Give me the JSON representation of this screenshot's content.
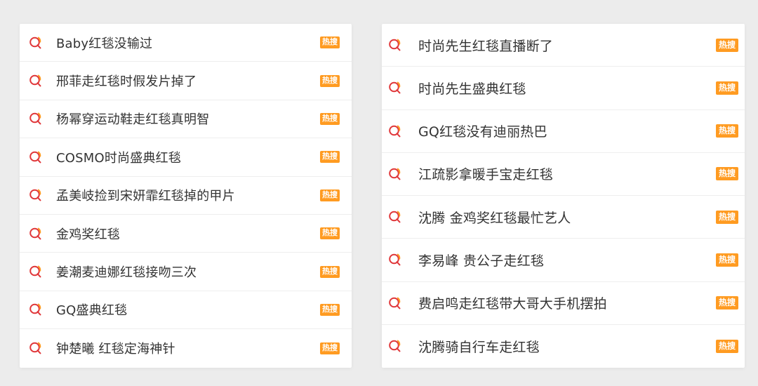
{
  "colors": {
    "badge": "#ff9b21",
    "icon_red": "#e0373a",
    "icon_orange": "#ff9b21"
  },
  "left_list": [
    {
      "label": "Baby红毯没输过",
      "badge": "热搜",
      "icon": "search-icon"
    },
    {
      "label": "邢菲走红毯时假发片掉了",
      "badge": "热搜",
      "icon": "search-icon"
    },
    {
      "label": "杨幂穿运动鞋走红毯真明智",
      "badge": "热搜",
      "icon": "search-icon"
    },
    {
      "label": "COSMO时尚盛典红毯",
      "badge": "热搜",
      "icon": "search-icon"
    },
    {
      "label": "孟美岐捡到宋妍霏红毯掉的甲片",
      "badge": "热搜",
      "icon": "search-icon"
    },
    {
      "label": "金鸡奖红毯",
      "badge": "热搜",
      "icon": "search-icon"
    },
    {
      "label": "姜潮麦迪娜红毯接吻三次",
      "badge": "热搜",
      "icon": "search-icon"
    },
    {
      "label": "GQ盛典红毯",
      "badge": "热搜",
      "icon": "search-icon"
    },
    {
      "label": "钟楚曦 红毯定海神针",
      "badge": "热搜",
      "icon": "search-icon"
    }
  ],
  "right_list": [
    {
      "label": "时尚先生红毯直播断了",
      "badge": "热搜",
      "icon": "search-icon"
    },
    {
      "label": "时尚先生盛典红毯",
      "badge": "热搜",
      "icon": "search-icon"
    },
    {
      "label": "GQ红毯没有迪丽热巴",
      "badge": "热搜",
      "icon": "search-icon"
    },
    {
      "label": "江疏影拿暖手宝走红毯",
      "badge": "热搜",
      "icon": "search-icon"
    },
    {
      "label": "沈腾 金鸡奖红毯最忙艺人",
      "badge": "热搜",
      "icon": "search-icon"
    },
    {
      "label": "李易峰 贵公子走红毯",
      "badge": "热搜",
      "icon": "search-icon"
    },
    {
      "label": "费启鸣走红毯带大哥大手机摆拍",
      "badge": "热搜",
      "icon": "search-icon"
    },
    {
      "label": "沈腾骑自行车走红毯",
      "badge": "热搜",
      "icon": "search-icon"
    }
  ]
}
